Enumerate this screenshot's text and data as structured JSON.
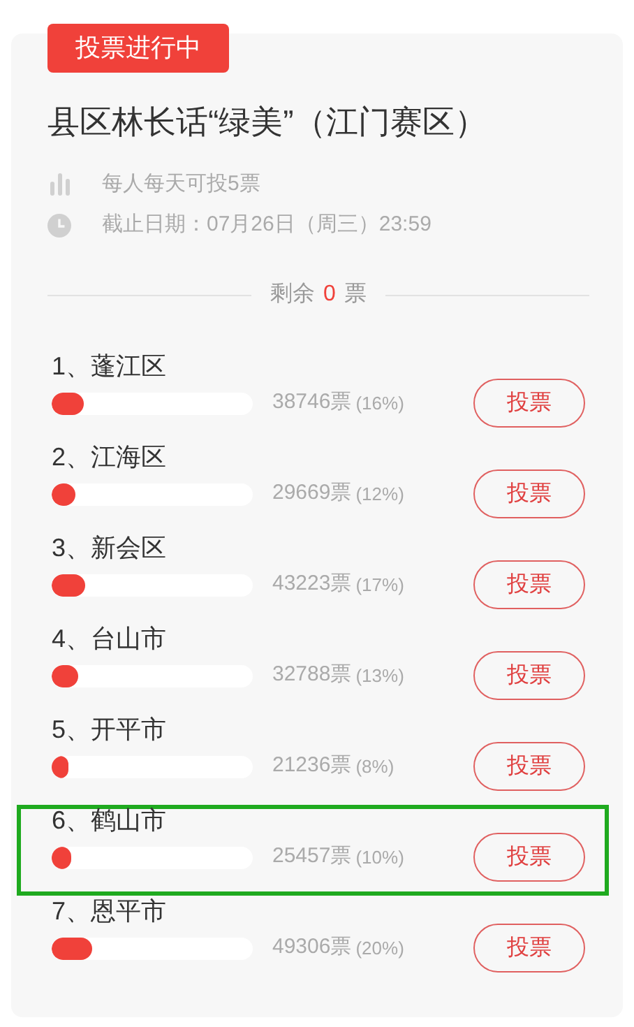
{
  "status_badge": "投票进行中",
  "title": "县区林长话“绿美”（江门赛区）",
  "info": [
    {
      "kind": "rule",
      "text": "每人每天可投5票"
    },
    {
      "kind": "deadline",
      "text": "截止日期：07月26日（周三）23:59"
    }
  ],
  "remaining": {
    "label": "剩余",
    "count": "0",
    "unit": "票"
  },
  "candidates": [
    {
      "name": "1、蓬江区",
      "level": 0.16,
      "votes": "38746票",
      "percent": "(16%)",
      "button": "投票",
      "highlighted": false
    },
    {
      "name": "2、江海区",
      "level": 0.12,
      "votes": "29669票",
      "percent": "(12%)",
      "button": "投票",
      "highlighted": false
    },
    {
      "name": "3、新会区",
      "level": 0.17,
      "votes": "43223票",
      "percent": "(17%)",
      "button": "投票",
      "highlighted": false
    },
    {
      "name": "4、台山市",
      "level": 0.13,
      "votes": "32788票",
      "percent": "(13%)",
      "button": "投票",
      "highlighted": false
    },
    {
      "name": "5、开平市",
      "level": 0.08,
      "votes": "21236票",
      "percent": "(8%)",
      "button": "投票",
      "highlighted": false
    },
    {
      "name": "6、鹤山市",
      "level": 0.1,
      "votes": "25457票",
      "percent": "(10%)",
      "button": "投票",
      "highlighted": true
    },
    {
      "name": "7、恩平市",
      "level": 0.2,
      "votes": "49306票",
      "percent": "(20%)",
      "button": "投票",
      "highlighted": false
    }
  ]
}
